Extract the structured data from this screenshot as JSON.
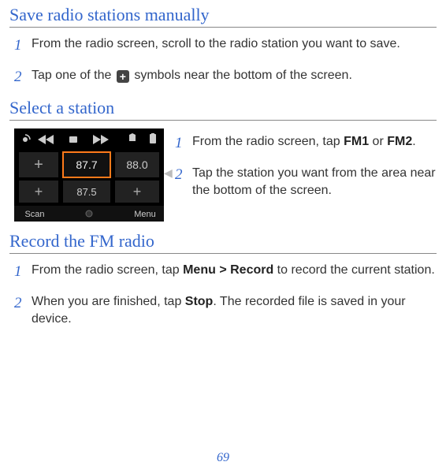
{
  "page_number": "69",
  "sections": {
    "save": {
      "heading": "Save radio stations manually",
      "step1": {
        "num": "1",
        "text": "From the radio screen, scroll to the radio station you want to save."
      },
      "step2": {
        "num": "2",
        "before": "Tap one of the ",
        "after": " symbols near the bottom of the screen.",
        "plus_glyph": "+"
      }
    },
    "select": {
      "heading": "Select a station",
      "step1": {
        "num": "1",
        "before": "From the radio screen, tap ",
        "fm1": "FM1",
        "or": " or ",
        "fm2": "FM2",
        "after": "."
      },
      "step2": {
        "num": "2",
        "text": "Tap the station you want from the area near the bottom of the screen."
      }
    },
    "record": {
      "heading": "Record the FM radio",
      "step1": {
        "num": "1",
        "before": "From the radio screen, tap ",
        "menu": "Menu",
        "gt": " > ",
        "record": "Record",
        "after": " to record the current station."
      },
      "step2": {
        "num": "2",
        "before": "When you are finished, tap ",
        "stop": "Stop",
        "after": ". The recorded file is saved in your device."
      }
    }
  },
  "radio_mock": {
    "freq1": "87.7",
    "freq2": "88.0",
    "freq3": "87.5",
    "scan": "Scan",
    "menu": "Menu"
  }
}
